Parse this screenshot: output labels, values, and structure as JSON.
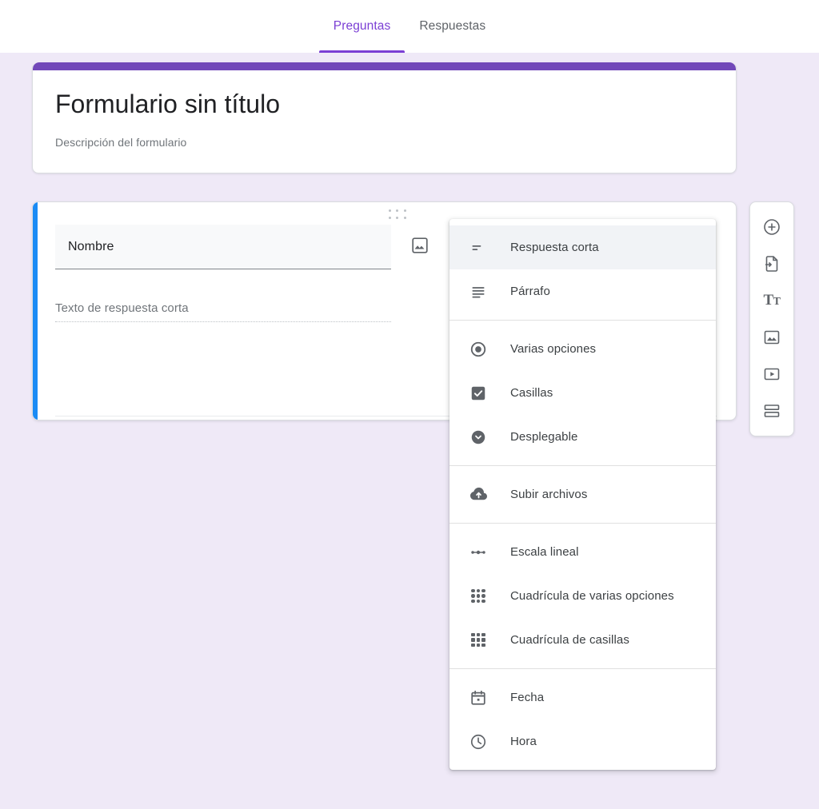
{
  "tabs": [
    {
      "label": "Preguntas",
      "active": true
    },
    {
      "label": "Respuestas",
      "active": false
    }
  ],
  "form_header": {
    "title": "Formulario sin título",
    "description": "Descripción del formulario",
    "stripe_color": "#7248B9"
  },
  "question": {
    "accent_color": "#1A8BF5",
    "title_value": "Nombre",
    "answer_placeholder": "Texto de respuesta corta",
    "image_button_name": "image-icon",
    "drag_handle_name": "drag-handle"
  },
  "side_toolbar": {
    "buttons": [
      {
        "name": "add-question-button",
        "icon": "add-circle-icon"
      },
      {
        "name": "import-questions-button",
        "icon": "import-file-icon"
      },
      {
        "name": "add-title-description-button",
        "icon": "title-text-icon",
        "glyph": "T",
        "glyph_small": "T"
      },
      {
        "name": "add-image-button",
        "icon": "image-icon"
      },
      {
        "name": "add-video-button",
        "icon": "video-icon"
      },
      {
        "name": "add-section-button",
        "icon": "section-icon"
      }
    ]
  },
  "type_menu": {
    "groups": [
      {
        "items": [
          {
            "label": "Respuesta corta",
            "icon": "short-answer-icon",
            "selected": true
          },
          {
            "label": "Párrafo",
            "icon": "paragraph-icon",
            "selected": false
          }
        ]
      },
      {
        "items": [
          {
            "label": "Varias opciones",
            "icon": "radio-button-icon",
            "selected": false
          },
          {
            "label": "Casillas",
            "icon": "checkbox-icon",
            "selected": false
          },
          {
            "label": "Desplegable",
            "icon": "dropdown-icon",
            "selected": false
          }
        ]
      },
      {
        "items": [
          {
            "label": "Subir archivos",
            "icon": "cloud-upload-icon",
            "selected": false
          }
        ]
      },
      {
        "items": [
          {
            "label": "Escala lineal",
            "icon": "linear-scale-icon",
            "selected": false
          },
          {
            "label": "Cuadrícula de varias opciones",
            "icon": "radio-grid-icon",
            "selected": false
          },
          {
            "label": "Cuadrícula de casillas",
            "icon": "checkbox-grid-icon",
            "selected": false
          }
        ]
      },
      {
        "items": [
          {
            "label": "Fecha",
            "icon": "calendar-icon",
            "selected": false
          },
          {
            "label": "Hora",
            "icon": "clock-icon",
            "selected": false
          }
        ]
      }
    ]
  },
  "colors": {
    "page_background": "#EFE9F7",
    "accent_purple": "#7B3FD4",
    "header_stripe": "#7248B9",
    "question_accent_blue": "#1A8BF5",
    "menu_selected": "#F1F3F6"
  }
}
